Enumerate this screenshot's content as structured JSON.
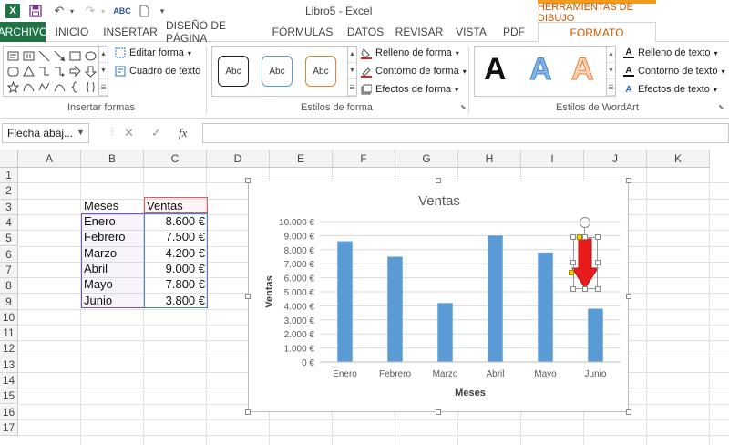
{
  "window": {
    "title": "Libro5 - Excel"
  },
  "context_tab_group": "HERRAMIENTAS DE DIBUJO",
  "tabs": [
    {
      "label": "ARCHIVO"
    },
    {
      "label": "INICIO"
    },
    {
      "label": "INSERTAR"
    },
    {
      "label": "DISEÑO DE PÁGINA"
    },
    {
      "label": "FÓRMULAS"
    },
    {
      "label": "DATOS"
    },
    {
      "label": "REVISAR"
    },
    {
      "label": "VISTA"
    },
    {
      "label": "PDF"
    },
    {
      "label": "FORMATO"
    }
  ],
  "ribbon": {
    "insert_shapes": {
      "label": "Insertar formas",
      "edit_shape": "Editar forma",
      "text_box": "Cuadro de texto"
    },
    "shape_styles": {
      "label": "Estilos de forma",
      "thumb_text": "Abc",
      "fill": "Relleno de forma",
      "outline": "Contorno de forma",
      "effects": "Efectos de forma"
    },
    "wordart_styles": {
      "label": "Estilos de WordArt",
      "glyph": "A",
      "text_fill": "Relleno de texto",
      "text_outline": "Contorno de texto",
      "text_effects": "Efectos de texto"
    }
  },
  "formula_bar": {
    "name_box": "Flecha abaj...",
    "fx": "fx",
    "cancel": "✕",
    "enter": "✓",
    "formula": ""
  },
  "grid": {
    "columns": [
      "A",
      "B",
      "C",
      "D",
      "E",
      "F",
      "G",
      "H",
      "I",
      "J",
      "K"
    ],
    "rows": [
      "1",
      "2",
      "3",
      "4",
      "5",
      "6",
      "7",
      "8",
      "9",
      "10",
      "11",
      "12",
      "13",
      "14",
      "15",
      "16",
      "17"
    ],
    "table": {
      "header": [
        "Meses",
        "Ventas"
      ],
      "rows": [
        [
          "Enero",
          "8.600 €"
        ],
        [
          "Febrero",
          "7.500 €"
        ],
        [
          "Marzo",
          "4.200 €"
        ],
        [
          "Abril",
          "9.000 €"
        ],
        [
          "Mayo",
          "7.800 €"
        ],
        [
          "Junio",
          "3.800 €"
        ]
      ]
    }
  },
  "colors": {
    "excel_green": "#217346",
    "context_orange": "#f29b1d",
    "bar_blue": "#5b9bd5",
    "arrow_red": "#e81c1c"
  },
  "chart_data": {
    "type": "bar",
    "title": "Ventas",
    "xlabel": "Meses",
    "ylabel": "Ventas",
    "categories": [
      "Enero",
      "Febrero",
      "Marzo",
      "Abril",
      "Mayo",
      "Junio"
    ],
    "values": [
      8600,
      7500,
      4200,
      9000,
      7800,
      3800
    ],
    "ylim": [
      0,
      10000
    ],
    "yticks": [
      "0 €",
      "1.000 €",
      "2.000 €",
      "3.000 €",
      "4.000 €",
      "5.000 €",
      "6.000 €",
      "7.000 €",
      "8.000 €",
      "9.000 €",
      "10.000 €"
    ],
    "grid": true,
    "legend": "none"
  }
}
